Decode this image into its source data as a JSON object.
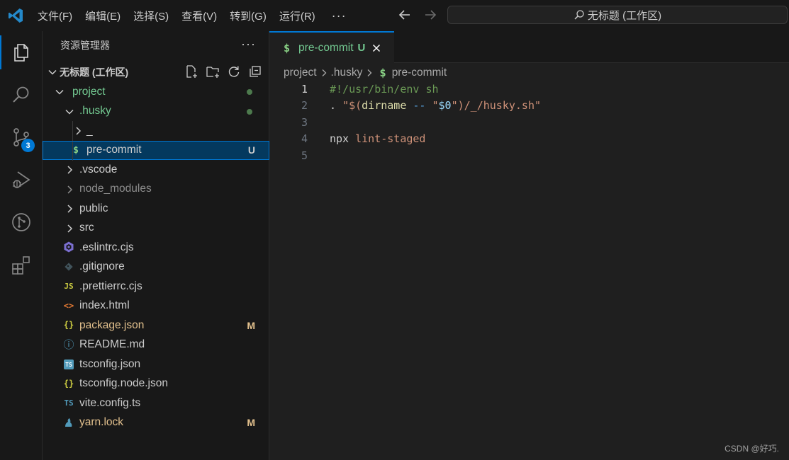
{
  "titlebar": {
    "menu": [
      "文件(F)",
      "编辑(E)",
      "选择(S)",
      "查看(V)",
      "转到(G)",
      "运行(R)"
    ],
    "more": "···",
    "command_center": "无标题 (工作区)"
  },
  "activity_bar": {
    "items": [
      "explorer-icon",
      "search-icon",
      "source-control-icon",
      "run-debug-icon",
      "git-graph-icon",
      "extensions-icon"
    ],
    "source_control_badge": "3",
    "accent_color": "#0078d4"
  },
  "sidebar": {
    "title": "资源管理器",
    "more": "···",
    "workspace_title": "无标题 (工作区)",
    "tree": [
      {
        "label": "project",
        "color": "#73c991"
      },
      {
        "label": ".husky",
        "color": "#73c991"
      },
      {
        "label": "_"
      },
      {
        "label": "pre-commit",
        "icon_text": "$",
        "decoration": "U",
        "color": "#cccccc"
      },
      {
        "label": ".vscode"
      },
      {
        "label": "node_modules"
      },
      {
        "label": "public"
      },
      {
        "label": "src"
      },
      {
        "label": ".eslintrc.cjs"
      },
      {
        "label": ".gitignore"
      },
      {
        "label": ".prettierrc.cjs",
        "icon_text": "JS"
      },
      {
        "label": "index.html",
        "icon_text": "<>"
      },
      {
        "label": "package.json",
        "icon_text": "{}",
        "decoration": "M"
      },
      {
        "label": "README.md",
        "icon_text": "ⓘ"
      },
      {
        "label": "tsconfig.json",
        "icon_text": "TS"
      },
      {
        "label": "tsconfig.node.json",
        "icon_text": "{}"
      },
      {
        "label": "vite.config.ts",
        "icon_text": "TS"
      },
      {
        "label": "yarn.lock",
        "decoration": "M"
      }
    ]
  },
  "editor": {
    "tab": {
      "icon_text": "$",
      "label": "pre-commit",
      "status": "U"
    },
    "breadcrumb": [
      "project",
      ".husky",
      "pre-commit"
    ],
    "breadcrumb_icon_text": "$",
    "lines": [
      {
        "num": "1",
        "text": "#!/usr/bin/env sh"
      },
      {
        "num": "2",
        "text": ". \"$(dirname -- \"$0\")/_/husky.sh\""
      },
      {
        "num": "3",
        "text": ""
      },
      {
        "num": "4",
        "text": "npx lint-staged"
      },
      {
        "num": "5",
        "text": ""
      }
    ]
  },
  "watermark": "CSDN @好巧."
}
